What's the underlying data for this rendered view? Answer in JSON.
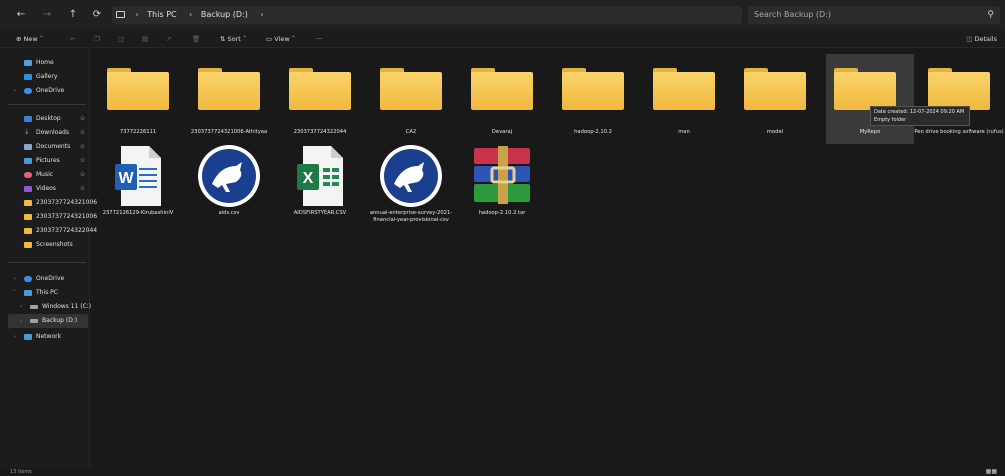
{
  "address": {
    "path": [
      "This PC",
      "Backup (D:)"
    ],
    "search_placeholder": "Search Backup (D:)"
  },
  "toolbar": {
    "new_label": "New",
    "sort_label": "Sort",
    "view_label": "View",
    "more_label": "···",
    "details_label": "Details"
  },
  "sidebar": {
    "top": [
      {
        "label": "Home",
        "icon": "home-icon"
      },
      {
        "label": "Gallery",
        "icon": "gallery-icon"
      },
      {
        "label": "OneDrive",
        "icon": "onedrive-icon"
      }
    ],
    "quick": [
      {
        "label": "Desktop",
        "icon": "desktop-icon"
      },
      {
        "label": "Downloads",
        "icon": "download-icon"
      },
      {
        "label": "Documents",
        "icon": "documents-icon"
      },
      {
        "label": "Pictures",
        "icon": "pictures-icon"
      },
      {
        "label": "Music",
        "icon": "music-icon"
      },
      {
        "label": "Videos",
        "icon": "videos-icon"
      },
      {
        "label": "2303737724321006",
        "icon": "folder-icon"
      },
      {
        "label": "2303737724321006",
        "icon": "folder-icon"
      },
      {
        "label": "2303737724322044",
        "icon": "folder-icon"
      },
      {
        "label": "Screenshots",
        "icon": "folder-icon"
      }
    ],
    "tree": [
      {
        "label": "OneDrive",
        "icon": "onedrive-icon"
      },
      {
        "label": "This PC",
        "icon": "pc-icon"
      },
      {
        "label": "Windows 11 (C:)",
        "icon": "drive-icon"
      },
      {
        "label": "Backup (D:)",
        "icon": "drive-icon"
      },
      {
        "label": "Network",
        "icon": "network-icon"
      }
    ]
  },
  "files": {
    "folders": [
      "73772226111",
      "2303737724321006-Athityaa",
      "2303737724322044",
      "CA2",
      "Devaraj",
      "hadoop-2.10.2",
      "man",
      "model",
      "MyRepo",
      "Pen drive booking software (rufus)"
    ],
    "row2": [
      {
        "label": "23772126129-KirubashiniV",
        "icon": "word-document-icon"
      },
      {
        "label": "aids.csv",
        "icon": "csv-bird-icon"
      },
      {
        "label": "AIDSFIRSTYEAR.CSV",
        "icon": "excel-icon"
      },
      {
        "label": "annual-enterprise-survey-2021-financial-year-provisional-csv",
        "icon": "csv-bird-icon"
      },
      {
        "label": "hadoop-2.10.2.tar",
        "icon": "archive-icon"
      }
    ]
  },
  "tooltip": {
    "line1": "Date created: 12-07-2024 09:20 AM",
    "line2": "Empty folder"
  },
  "status": {
    "left": "13 items"
  }
}
